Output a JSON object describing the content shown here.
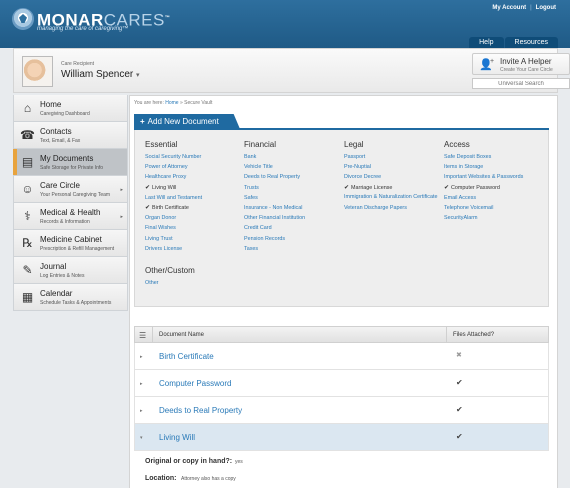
{
  "header": {
    "logo_strong": "MONAR",
    "logo_light": "CARES",
    "tm": "™",
    "tagline": "managing the care of caregiving™",
    "links": [
      "My Account",
      "Logout"
    ],
    "separator": "|",
    "tabs": [
      "Help",
      "Resources"
    ]
  },
  "recipient": {
    "label": "Care Recipient",
    "name": "William Spencer",
    "caret": "▾"
  },
  "invite": {
    "title": "Invite A Helper",
    "subtitle": "Create Your Care Circle"
  },
  "search": {
    "placeholder": "Universal Search"
  },
  "sidebar": {
    "items": [
      {
        "title": "Home",
        "sub": "Caregiving Dashboard",
        "icon": "home-icon",
        "glyph": "⌂",
        "arrow": ""
      },
      {
        "title": "Contacts",
        "sub": "Text, Email, & Fax",
        "icon": "phone-icon",
        "glyph": "☎",
        "arrow": ""
      },
      {
        "title": "My Documents",
        "sub": "Safe Storage for Private Info",
        "icon": "folder-icon",
        "glyph": "▤",
        "arrow": ""
      },
      {
        "title": "Care Circle",
        "sub": "Your Personal Caregiving Team",
        "icon": "people-icon",
        "glyph": "☺",
        "arrow": "▸"
      },
      {
        "title": "Medical & Health",
        "sub": "Records & Information",
        "icon": "caduceus-icon",
        "glyph": "⚕",
        "arrow": "▸"
      },
      {
        "title": "Medicine Cabinet",
        "sub": "Prescription & Refill Management",
        "icon": "rx-icon",
        "glyph": "℞",
        "arrow": ""
      },
      {
        "title": "Journal",
        "sub": "Log Entries & Notes",
        "icon": "journal-icon",
        "glyph": "✎",
        "arrow": ""
      },
      {
        "title": "Calendar",
        "sub": "Schedule Tasks & Appointments",
        "icon": "calendar-icon",
        "glyph": "▦",
        "arrow": ""
      }
    ]
  },
  "breadcrumb": {
    "prefix": "You are here:",
    "home": "Home",
    "arrow": "»",
    "current": "Secure Vault"
  },
  "add_document": {
    "plus": "+",
    "label": "Add New Document"
  },
  "categories": {
    "essential": {
      "title": "Essential",
      "items": [
        {
          "text": "Social Security Number",
          "checked": false
        },
        {
          "text": "Power of Attorney",
          "checked": false
        },
        {
          "text": "Healthcare Proxy",
          "checked": false
        },
        {
          "text": "Living Will",
          "checked": true
        },
        {
          "text": "Last Will and Testament",
          "checked": false
        },
        {
          "text": "Birth Certificate",
          "checked": true
        },
        {
          "text": "Organ Donor",
          "checked": false
        },
        {
          "text": "Final Wishes",
          "checked": false
        },
        {
          "text": "Living Trust",
          "checked": false
        },
        {
          "text": "Drivers License",
          "checked": false
        }
      ]
    },
    "financial": {
      "title": "Financial",
      "items": [
        {
          "text": "Bank",
          "checked": false
        },
        {
          "text": "Vehicle Title",
          "checked": false
        },
        {
          "text": "Deeds to Real Property",
          "checked": false
        },
        {
          "text": "Trusts",
          "checked": false
        },
        {
          "text": "Safes",
          "checked": false
        },
        {
          "text": "Insurance - Non Medical",
          "checked": false
        },
        {
          "text": "Other Financial Institution",
          "checked": false
        },
        {
          "text": "Credit Card",
          "checked": false
        },
        {
          "text": "Pension Records",
          "checked": false
        },
        {
          "text": "Taxes",
          "checked": false
        }
      ]
    },
    "legal": {
      "title": "Legal",
      "items": [
        {
          "text": "Passport",
          "checked": false,
          "wrap": false
        },
        {
          "text": "Pre-Nuptial",
          "checked": false,
          "wrap": false
        },
        {
          "text": "Divorce Decree",
          "checked": false,
          "wrap": false
        },
        {
          "text": "Marriage License",
          "checked": true,
          "wrap": false
        },
        {
          "text": "Immigration & Naturalization Certificate",
          "checked": false,
          "wrap": true
        },
        {
          "text": "Veteran Discharge Papers",
          "checked": false,
          "wrap": false
        }
      ]
    },
    "access": {
      "title": "Access",
      "items": [
        {
          "text": "Safe Deposit Boxes",
          "checked": false,
          "wrap": false
        },
        {
          "text": "Items in Storage",
          "checked": false,
          "wrap": false
        },
        {
          "text": "Important Websites & Passwords",
          "checked": false,
          "wrap": true
        },
        {
          "text": "Computer Password",
          "checked": true,
          "wrap": false
        },
        {
          "text": "Email Access",
          "checked": false,
          "wrap": false
        },
        {
          "text": "Telephone Voicemail",
          "checked": false,
          "wrap": false
        },
        {
          "text": "SecurityAlarm",
          "checked": false,
          "wrap": false
        }
      ]
    },
    "other": {
      "title": "Other/Custom",
      "items": [
        {
          "text": "Other",
          "checked": false
        }
      ]
    }
  },
  "table": {
    "menu_glyph": "☰",
    "headers": {
      "name": "Document Name",
      "files": "Files Attached?"
    },
    "rows": [
      {
        "name": "Birth Certificate",
        "mark": "✖",
        "mark_type": "x",
        "expanded": false
      },
      {
        "name": "Computer Password",
        "mark": "✔",
        "mark_type": "check",
        "expanded": false
      },
      {
        "name": "Deeds to Real Property",
        "mark": "✔",
        "mark_type": "check",
        "expanded": false
      },
      {
        "name": "Living Will",
        "mark": "✔",
        "mark_type": "check",
        "expanded": true
      }
    ],
    "arrows": {
      "collapsed": "▸",
      "expanded": "▾"
    },
    "details": [
      {
        "label": "Original or copy in hand?:",
        "value": "yes"
      },
      {
        "label": "Location:",
        "value": "Attorney also has a copy"
      }
    ]
  },
  "colors": {
    "brand_blue": "#1f6aa1",
    "link_blue": "#2a7ab8",
    "active_accent": "#e8a33d"
  }
}
